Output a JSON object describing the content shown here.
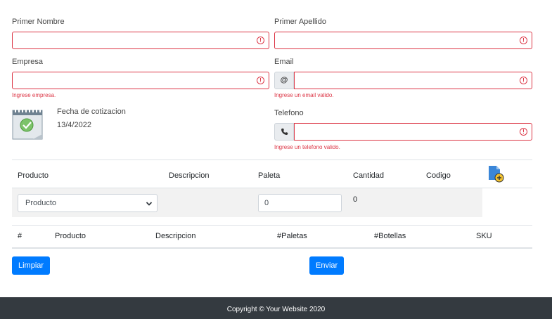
{
  "form": {
    "first_name_label": "Primer Nombre",
    "first_name_value": "",
    "last_name_label": "Primer Apellido",
    "last_name_value": "",
    "company_label": "Empresa",
    "company_value": "",
    "company_error": "Ingrese empresa.",
    "email_label": "Email",
    "email_value": "",
    "email_addon": "@",
    "email_error": "Ingrese un email valido.",
    "phone_label": "Telefono",
    "phone_value": "",
    "phone_error": "Ingrese un telefono valido.",
    "quote_date_label": "Fecha de cotizacion",
    "quote_date_value": "13/4/2022"
  },
  "product_table": {
    "headers": [
      "Producto",
      "Descripcion",
      "Paleta",
      "Cantidad",
      "Codigo"
    ],
    "product_select_value": "Producto",
    "paleta_value": "0",
    "cantidad_value": "0"
  },
  "items_table": {
    "headers": [
      "#",
      "Producto",
      "Descripcion",
      "#Paletas",
      "#Botellas",
      "SKU"
    ]
  },
  "buttons": {
    "clear": "Limpiar",
    "send": "Enviar"
  },
  "footer": {
    "text": "Copyright © Your Website 2020"
  },
  "colors": {
    "error": "#dc3545",
    "primary": "#007bff",
    "footer_bg": "#343a40"
  },
  "icons": {
    "error": "exclamation-circle-icon",
    "phone": "phone-icon",
    "calendar": "calendar-check-icon",
    "add_file": "file-add-icon",
    "dropdown": "chevron-down-icon"
  }
}
